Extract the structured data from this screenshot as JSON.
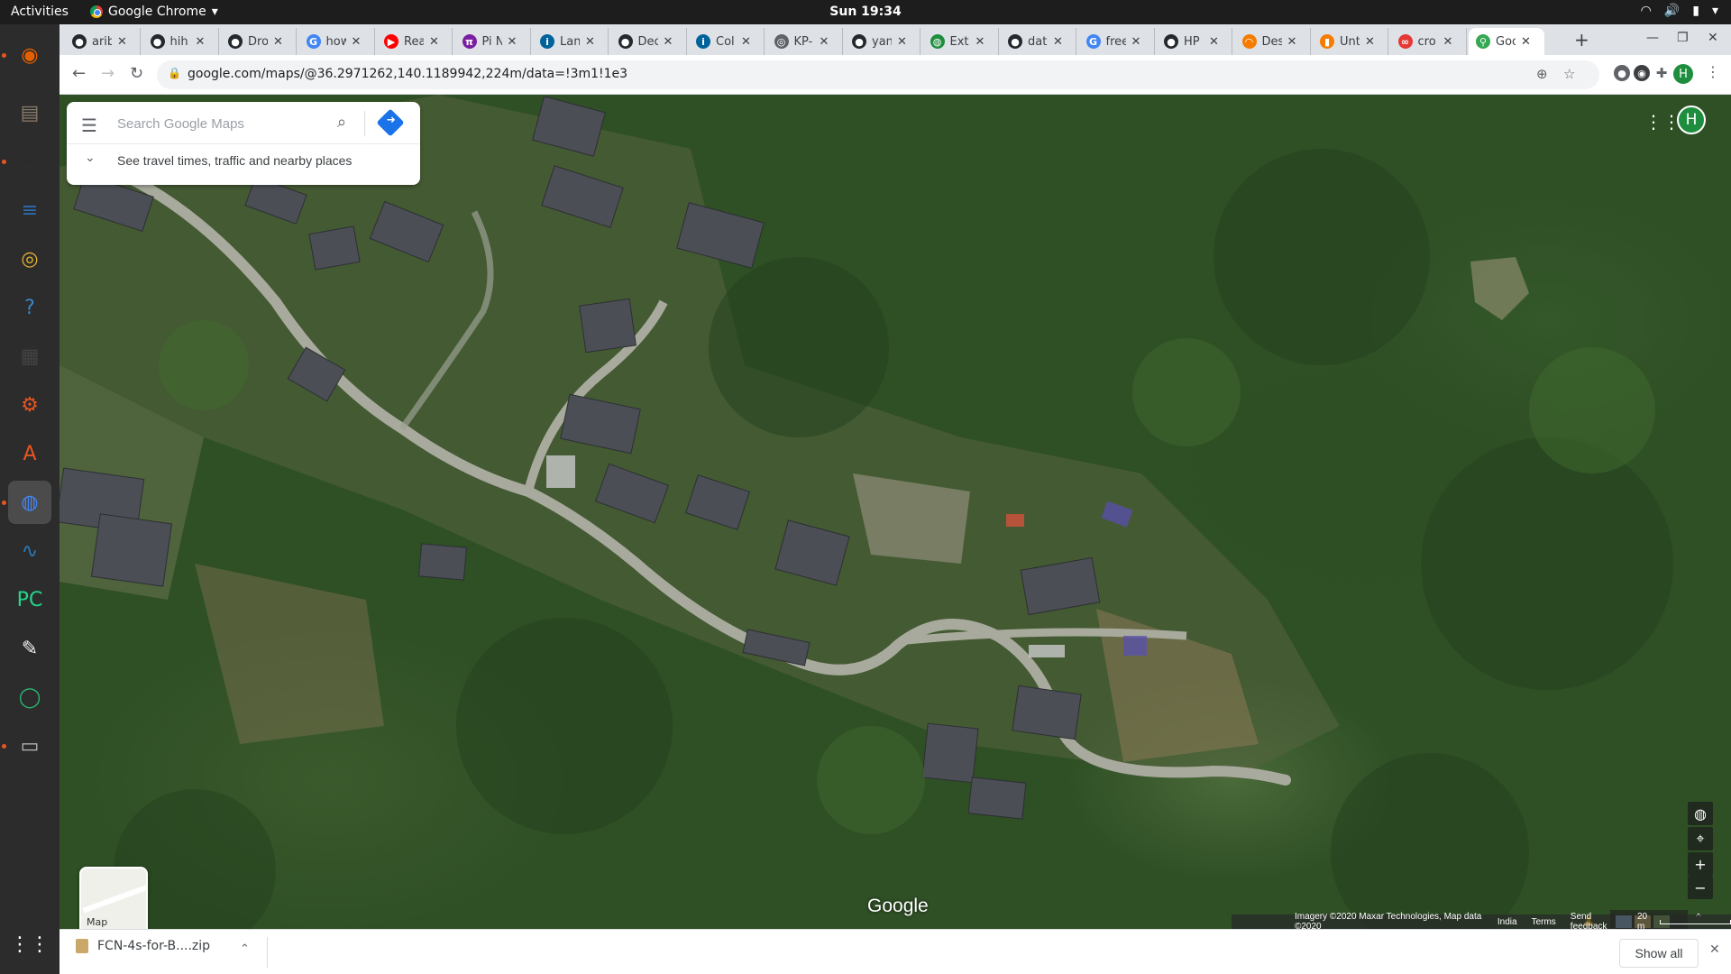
{
  "topbar": {
    "activities": "Activities",
    "app_name": "Google Chrome",
    "clock": "Sun 19:34"
  },
  "dock": {
    "apps": [
      {
        "name": "firefox",
        "icon": "firefox-icon",
        "color": "#e66000"
      },
      {
        "name": "files",
        "icon": "files-icon",
        "color": "#8a7b6b"
      },
      {
        "name": "terminal",
        "icon": "terminal-icon",
        "color": "#2b2b2b"
      },
      {
        "name": "writer",
        "icon": "document-icon",
        "color": "#2a6db5"
      },
      {
        "name": "rhythmbox",
        "icon": "speaker-icon",
        "color": "#e2b32f"
      },
      {
        "name": "help",
        "icon": "help-icon",
        "color": "#3d85c6"
      },
      {
        "name": "video-editor",
        "icon": "clapper-icon",
        "color": "#444444"
      },
      {
        "name": "settings",
        "icon": "gear-icon",
        "color": "#e95420"
      },
      {
        "name": "software",
        "icon": "software-icon",
        "color": "#e95420"
      },
      {
        "name": "chrome",
        "icon": "chrome-icon",
        "color": "#4285f4"
      },
      {
        "name": "monitor",
        "icon": "system-monitor-icon",
        "color": "#2a7ab8"
      },
      {
        "name": "pycharm",
        "icon": "pycharm-icon",
        "color": "#21d789"
      },
      {
        "name": "text-editor",
        "icon": "notepad-icon",
        "color": "#f0f0f0"
      },
      {
        "name": "update",
        "icon": "refresh-ring-icon",
        "color": "#2bb673"
      },
      {
        "name": "scanner",
        "icon": "scanner-icon",
        "color": "#bbbbbb"
      },
      {
        "name": "app-grid",
        "icon": "app-grid-icon",
        "color": "#ffffff"
      }
    ]
  },
  "tabs": [
    {
      "label": "arib",
      "icon": "github-icon",
      "color": "#24292e"
    },
    {
      "label": "hih",
      "icon": "github-icon",
      "color": "#24292e"
    },
    {
      "label": "Dro",
      "icon": "github-icon",
      "color": "#24292e"
    },
    {
      "label": "how",
      "icon": "google-icon",
      "color": "#4285f4"
    },
    {
      "label": "Rea",
      "icon": "youtube-icon",
      "color": "#ff0000"
    },
    {
      "label": "Pi N",
      "icon": "pi-icon",
      "color": "#7b1fa2"
    },
    {
      "label": "Lan",
      "icon": "ieee-icon",
      "color": "#00629b"
    },
    {
      "label": "Dec",
      "icon": "github-icon",
      "color": "#24292e"
    },
    {
      "label": "Col",
      "icon": "ieee-icon",
      "color": "#00629b"
    },
    {
      "label": "KP-",
      "icon": "compass-icon",
      "color": "#5f6368"
    },
    {
      "label": "yan",
      "icon": "github-icon",
      "color": "#24292e"
    },
    {
      "label": "Ext",
      "icon": "globe-icon",
      "color": "#1e8e3e"
    },
    {
      "label": "dat",
      "icon": "github-icon",
      "color": "#24292e"
    },
    {
      "label": "free",
      "icon": "google-icon",
      "color": "#4285f4"
    },
    {
      "label": "HP",
      "icon": "github-icon",
      "color": "#24292e"
    },
    {
      "label": "Des",
      "icon": "arc-icon",
      "color": "#f57c00"
    },
    {
      "label": "Unt",
      "icon": "bookmark-icon",
      "color": "#f57c00"
    },
    {
      "label": "cro",
      "icon": "infinity-icon",
      "color": "#e53935"
    },
    {
      "label": "Goo",
      "icon": "maps-pin-icon",
      "color": "#34a853",
      "active": true
    }
  ],
  "toolbar": {
    "url": "google.com/maps/@36.2971262,140.1189942,224m/data=!3m1!1e3"
  },
  "maps": {
    "search_placeholder": "Search Google Maps",
    "travel_times": "See travel times, traffic and nearby places",
    "avatar_letter": "H",
    "map_toggle_label": "Map",
    "logo": "Google",
    "attribution": {
      "imagery": "Imagery ©2020 Maxar Technologies, Map data ©2020",
      "country": "India",
      "terms": "Terms",
      "feedback": "Send feedback",
      "scale": "20 m"
    }
  },
  "downloads": {
    "filename": "FCN-4s-for-B....zip",
    "show_all": "Show all"
  }
}
